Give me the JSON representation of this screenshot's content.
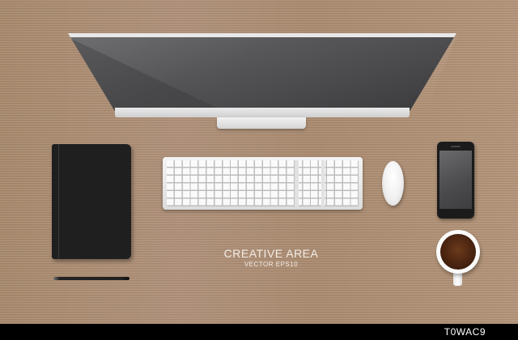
{
  "scene": {
    "title": "CREATIVE AREA",
    "subtitle": "VECTOR EPS10"
  },
  "footer": {
    "image_id": "T0WAC9"
  },
  "objects": {
    "monitor": "desktop-monitor-icon",
    "keyboard": "keyboard-icon",
    "mouse": "mouse-icon",
    "phone": "smartphone-icon",
    "coffee": "coffee-cup-icon",
    "notebook": "notebook-icon",
    "pencil": "pencil-icon"
  },
  "colors": {
    "wood": "#a98a6c",
    "text": "#f4ede6",
    "footer": "#000000"
  }
}
